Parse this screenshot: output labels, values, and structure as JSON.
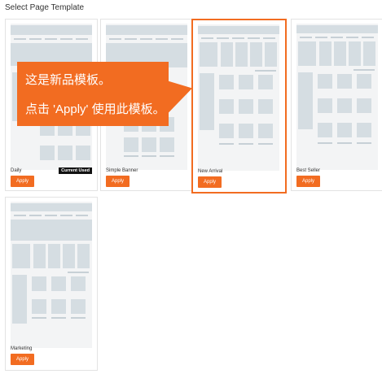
{
  "page": {
    "heading": "Select Page Template"
  },
  "templates": [
    {
      "name": "Daily",
      "badge": "Current Used",
      "apply_label": "Apply"
    },
    {
      "name": "Simple Banner",
      "apply_label": "Apply"
    },
    {
      "name": "New Arrival",
      "apply_label": "Apply"
    },
    {
      "name": "Best Seller",
      "apply_label": "Apply"
    },
    {
      "name": "Marketing",
      "apply_label": "Apply"
    }
  ],
  "tooltip": {
    "line1": "这是新品模板。",
    "line2": "点击 'Apply' 使用此模板。"
  },
  "colors": {
    "accent": "#f26c21",
    "badge_bg": "#111111",
    "thumb_bg": "#f3f4f5",
    "thumb_block": "#d5dde2"
  }
}
